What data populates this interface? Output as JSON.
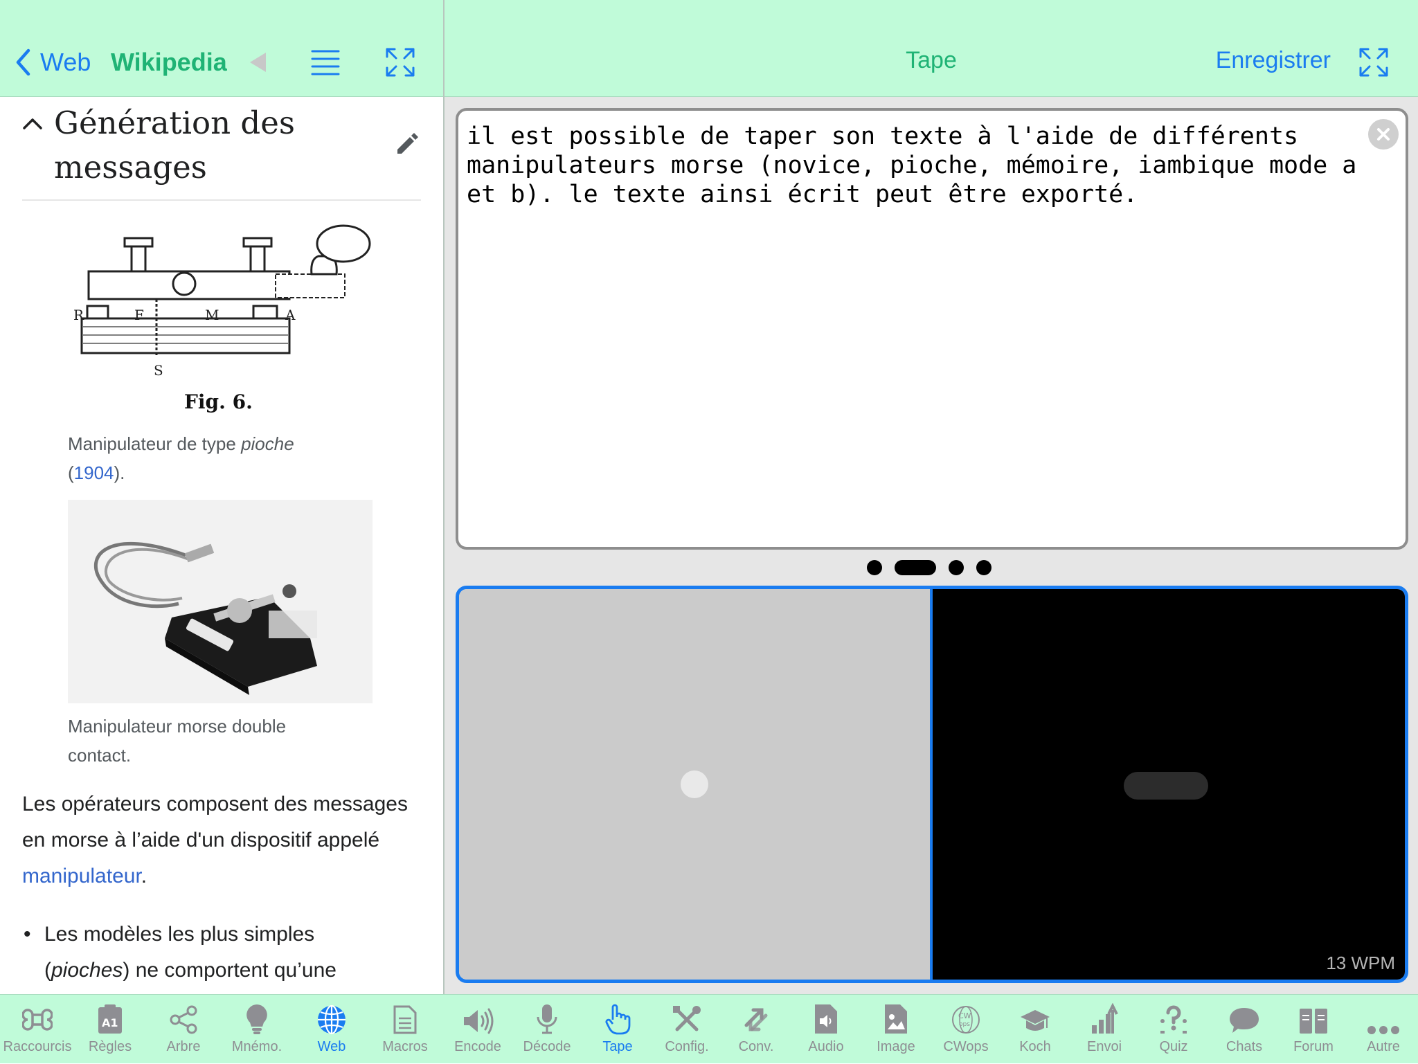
{
  "left_nav": {
    "back_label": "Web",
    "title": "Wikipedia",
    "icons": [
      "back-triangle-icon",
      "menu-list-icon",
      "expand-icon"
    ]
  },
  "article": {
    "section_title": "Génération des messages",
    "figure1": {
      "fig_label": "Fig. 6.",
      "caption_prefix": "Manipulateur de type",
      "caption_italic": "pioche",
      "caption_open": "(",
      "caption_link": "1904",
      "caption_close": ")."
    },
    "figure2": {
      "caption": "Manipulateur morse double contact."
    },
    "paragraph": {
      "text_before": "Les opérateurs composent des messages en morse à l’aide d'un dispositif appelé",
      "link": "manipulateur",
      "text_after": "."
    },
    "bullet": {
      "text_before": "Les modèles les plus simples (",
      "italic": "pioches",
      "text_after": ") ne comportent qu’une"
    }
  },
  "right_nav": {
    "title": "Tape",
    "save_label": "Enregistrer"
  },
  "tape": {
    "text": "il est possible de taper son texte à l'aide de différents manipulateurs morse (novice, pioche, mémoire, iambique mode a et b). le texte ainsi écrit peut être exporté.",
    "wpm": "13 WPM"
  },
  "tabs": [
    {
      "label": "Raccourcis",
      "icon": "command-icon",
      "active": false
    },
    {
      "label": "Règles",
      "icon": "rules-icon",
      "active": false
    },
    {
      "label": "Arbre",
      "icon": "tree-share-icon",
      "active": false
    },
    {
      "label": "Mnémo.",
      "icon": "lightbulb-icon",
      "active": false
    },
    {
      "label": "Web",
      "icon": "globe-icon",
      "active": true
    },
    {
      "label": "Macros",
      "icon": "document-icon",
      "active": false
    },
    {
      "label": "Encode",
      "icon": "speaker-icon",
      "active": false
    },
    {
      "label": "Décode",
      "icon": "microphone-icon",
      "active": false
    },
    {
      "label": "Tape",
      "icon": "hand-pointer-icon",
      "active": true
    },
    {
      "label": "Config.",
      "icon": "tools-icon",
      "active": false
    },
    {
      "label": "Conv.",
      "icon": "convert-arrows-icon",
      "active": false
    },
    {
      "label": "Audio",
      "icon": "audio-file-icon",
      "active": false
    },
    {
      "label": "Image",
      "icon": "image-file-icon",
      "active": false
    },
    {
      "label": "CWops",
      "icon": "cwops-globe-icon",
      "active": false
    },
    {
      "label": "Koch",
      "icon": "graduation-cap-icon",
      "active": false
    },
    {
      "label": "Envoi",
      "icon": "send-chart-icon",
      "active": false
    },
    {
      "label": "Quiz",
      "icon": "quiz-icon",
      "active": false
    },
    {
      "label": "Chats",
      "icon": "chat-bubble-icon",
      "active": false
    },
    {
      "label": "Forum",
      "icon": "forum-icon",
      "active": false
    },
    {
      "label": "Autre",
      "icon": "more-icon",
      "active": false
    }
  ],
  "colors": {
    "nav_bg": "#c0fbd9",
    "accent_blue": "#1a7cf0",
    "accent_green": "#1fb375",
    "link": "#3366cc"
  }
}
